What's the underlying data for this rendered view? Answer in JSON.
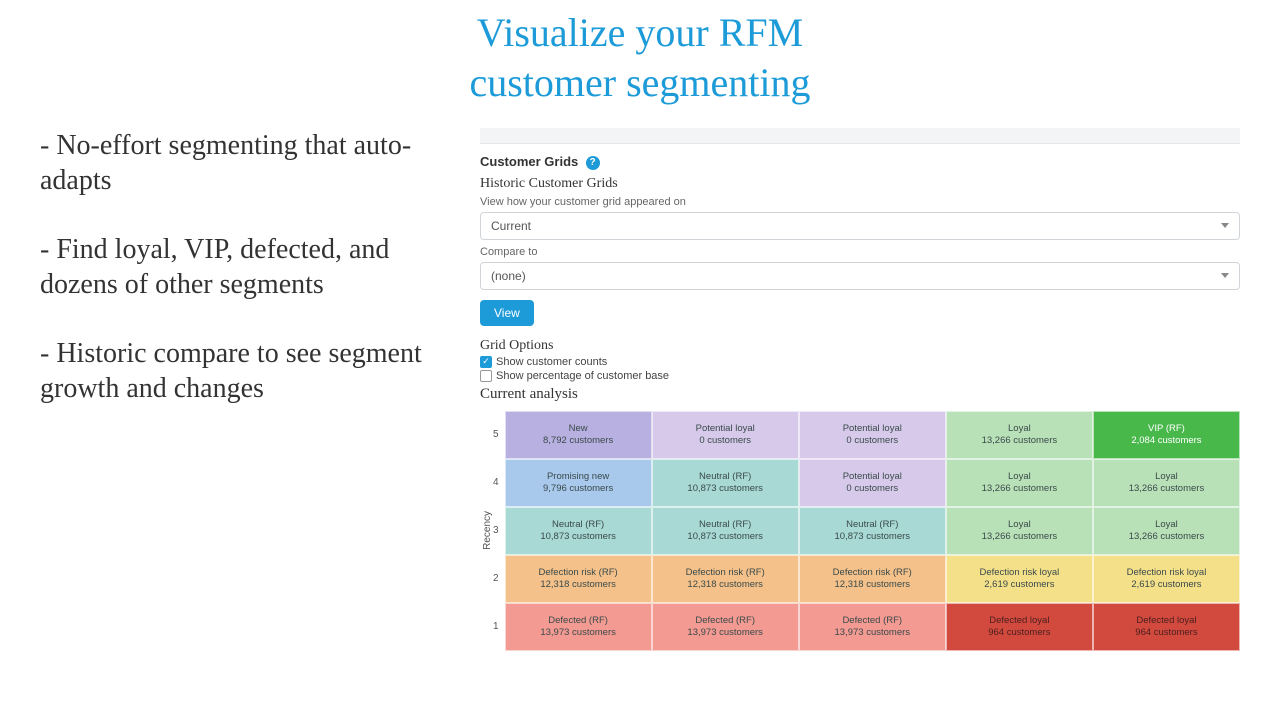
{
  "hero": {
    "title_line1": "Visualize your RFM",
    "title_line2": "customer segmenting"
  },
  "bullets": [
    "- No-effort segmenting that auto-adapts",
    "- Find loyal, VIP, defected, and dozens of other segments",
    "- Historic compare to see segment growth and changes"
  ],
  "panel": {
    "section_title": "Customer Grids",
    "help_icon": "?",
    "historic_heading": "Historic Customer Grids",
    "historic_hint": "View how your customer grid appeared on",
    "select_view_value": "Current",
    "compare_label": "Compare to",
    "select_compare_value": "(none)",
    "view_button": "View",
    "grid_options_title": "Grid Options",
    "opt_counts_label": "Show customer counts",
    "opt_counts_checked": true,
    "opt_percent_label": "Show percentage of customer base",
    "opt_percent_checked": false,
    "analysis_title": "Current analysis",
    "y_axis_label": "Recency",
    "y_ticks": [
      "5",
      "4",
      "3",
      "2",
      "1"
    ],
    "customers_suffix": "customers"
  },
  "grid": {
    "rows": [
      [
        {
          "name": "New",
          "count": "8,792",
          "cls": "c-new"
        },
        {
          "name": "Potential loyal",
          "count": "0",
          "cls": "c-potential"
        },
        {
          "name": "Potential loyal",
          "count": "0",
          "cls": "c-potential"
        },
        {
          "name": "Loyal",
          "count": "13,266",
          "cls": "c-loyal"
        },
        {
          "name": "VIP (RF)",
          "count": "2,084",
          "cls": "c-vip"
        }
      ],
      [
        {
          "name": "Promising new",
          "count": "9,796",
          "cls": "c-promising"
        },
        {
          "name": "Neutral (RF)",
          "count": "10,873",
          "cls": "c-neutral"
        },
        {
          "name": "Potential loyal",
          "count": "0",
          "cls": "c-potential"
        },
        {
          "name": "Loyal",
          "count": "13,266",
          "cls": "c-loyal"
        },
        {
          "name": "Loyal",
          "count": "13,266",
          "cls": "c-loyal"
        }
      ],
      [
        {
          "name": "Neutral (RF)",
          "count": "10,873",
          "cls": "c-neutral"
        },
        {
          "name": "Neutral (RF)",
          "count": "10,873",
          "cls": "c-neutral"
        },
        {
          "name": "Neutral (RF)",
          "count": "10,873",
          "cls": "c-neutral"
        },
        {
          "name": "Loyal",
          "count": "13,266",
          "cls": "c-loyal"
        },
        {
          "name": "Loyal",
          "count": "13,266",
          "cls": "c-loyal"
        }
      ],
      [
        {
          "name": "Defection risk (RF)",
          "count": "12,318",
          "cls": "c-defrisk"
        },
        {
          "name": "Defection risk (RF)",
          "count": "12,318",
          "cls": "c-defrisk"
        },
        {
          "name": "Defection risk (RF)",
          "count": "12,318",
          "cls": "c-defrisk"
        },
        {
          "name": "Defection risk loyal",
          "count": "2,619",
          "cls": "c-defriskloy"
        },
        {
          "name": "Defection risk loyal",
          "count": "2,619",
          "cls": "c-defriskloy"
        }
      ],
      [
        {
          "name": "Defected (RF)",
          "count": "13,973",
          "cls": "c-defected"
        },
        {
          "name": "Defected (RF)",
          "count": "13,973",
          "cls": "c-defected"
        },
        {
          "name": "Defected (RF)",
          "count": "13,973",
          "cls": "c-defected"
        },
        {
          "name": "Defected loyal",
          "count": "964",
          "cls": "c-defloyal"
        },
        {
          "name": "Defected loyal",
          "count": "964",
          "cls": "c-defloyal"
        }
      ]
    ]
  }
}
